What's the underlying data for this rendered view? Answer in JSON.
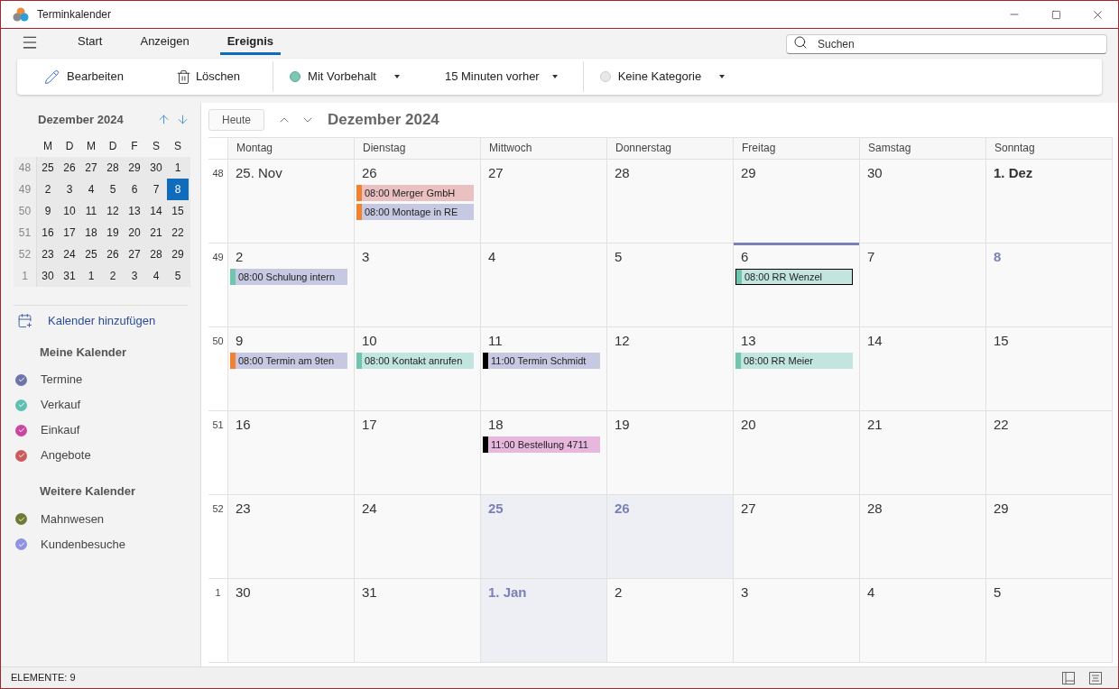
{
  "window": {
    "title": "Terminkalender"
  },
  "tabs": [
    {
      "label": "Start",
      "selected": false
    },
    {
      "label": "Anzeigen",
      "selected": false
    },
    {
      "label": "Ereignis",
      "selected": true
    }
  ],
  "search": {
    "placeholder": "Suchen"
  },
  "ribbon": {
    "edit": "Bearbeiten",
    "delete": "Löschen",
    "status": {
      "label": "Mit Vorbehalt",
      "color": "#7fc6b2"
    },
    "reminder": "15 Minuten vorher",
    "category": {
      "label": "Keine Kategorie",
      "color": "#e8e8e8"
    }
  },
  "mini_calendar": {
    "title": "Dezember 2024",
    "weekdays": [
      "M",
      "D",
      "M",
      "D",
      "F",
      "S",
      "S"
    ],
    "weeks": [
      {
        "number": "48",
        "days": [
          {
            "label": "25",
            "selected": false
          },
          {
            "label": "26",
            "selected": false
          },
          {
            "label": "27",
            "selected": false
          },
          {
            "label": "28",
            "selected": false
          },
          {
            "label": "29",
            "selected": false
          },
          {
            "label": "30",
            "selected": false
          },
          {
            "label": "1",
            "selected": false
          }
        ]
      },
      {
        "number": "49",
        "days": [
          {
            "label": "2",
            "selected": false
          },
          {
            "label": "3",
            "selected": false
          },
          {
            "label": "4",
            "selected": false
          },
          {
            "label": "5",
            "selected": false
          },
          {
            "label": "6",
            "selected": false
          },
          {
            "label": "7",
            "selected": false
          },
          {
            "label": "8",
            "selected": true
          }
        ]
      },
      {
        "number": "50",
        "days": [
          {
            "label": "9",
            "selected": false
          },
          {
            "label": "10",
            "selected": false
          },
          {
            "label": "11",
            "selected": false
          },
          {
            "label": "12",
            "selected": false
          },
          {
            "label": "13",
            "selected": false
          },
          {
            "label": "14",
            "selected": false
          },
          {
            "label": "15",
            "selected": false
          }
        ]
      },
      {
        "number": "51",
        "days": [
          {
            "label": "16",
            "selected": false
          },
          {
            "label": "17",
            "selected": false
          },
          {
            "label": "18",
            "selected": false
          },
          {
            "label": "19",
            "selected": false
          },
          {
            "label": "20",
            "selected": false
          },
          {
            "label": "21",
            "selected": false
          },
          {
            "label": "22",
            "selected": false
          }
        ]
      },
      {
        "number": "52",
        "days": [
          {
            "label": "23",
            "selected": false
          },
          {
            "label": "24",
            "selected": false
          },
          {
            "label": "25",
            "selected": false
          },
          {
            "label": "26",
            "selected": false
          },
          {
            "label": "27",
            "selected": false
          },
          {
            "label": "28",
            "selected": false
          },
          {
            "label": "29",
            "selected": false
          }
        ]
      },
      {
        "number": "1",
        "days": [
          {
            "label": "30",
            "selected": false
          },
          {
            "label": "31",
            "selected": false
          },
          {
            "label": "1",
            "selected": false
          },
          {
            "label": "2",
            "selected": false
          },
          {
            "label": "3",
            "selected": false
          },
          {
            "label": "4",
            "selected": false
          },
          {
            "label": "5",
            "selected": false
          }
        ]
      }
    ]
  },
  "add_calendar": "Kalender hinzufügen",
  "calendar_groups": [
    {
      "title": "Meine Kalender",
      "items": [
        {
          "label": "Termine",
          "color": "#6e74a9",
          "checked": true
        },
        {
          "label": "Verkauf",
          "color": "#5fbfb0",
          "checked": true
        },
        {
          "label": "Einkauf",
          "color": "#c9479e",
          "checked": true
        },
        {
          "label": "Angebote",
          "color": "#cc5c5c",
          "checked": true
        }
      ]
    },
    {
      "title": "Weitere Kalender",
      "items": [
        {
          "label": "Mahnwesen",
          "color": "#6f7a35",
          "checked": true
        },
        {
          "label": "Kundenbesuche",
          "color": "#8f93e0",
          "checked": true
        }
      ]
    }
  ],
  "month_view": {
    "today_button": "Heute",
    "title": "Dezember 2024",
    "weekdays": [
      "Montag",
      "Dienstag",
      "Mittwoch",
      "Donnerstag",
      "Freitag",
      "Samstag",
      "Sonntag"
    ],
    "weeks": [
      {
        "number": "48",
        "days": [
          {
            "label": "25. Nov",
            "kind": "plain",
            "selected": false
          },
          {
            "label": "26",
            "kind": "plain",
            "selected": false,
            "events": [
              {
                "text": "08:00 Merger GmbH",
                "color": "#f4812e",
                "kind": "angebote",
                "selected": false
              },
              {
                "text": "08:00 Montage in RE",
                "color": "#f4812e",
                "kind": "termine",
                "selected": false
              }
            ]
          },
          {
            "label": "27",
            "kind": "plain",
            "selected": false
          },
          {
            "label": "28",
            "kind": "plain",
            "selected": false
          },
          {
            "label": "29",
            "kind": "plain",
            "selected": false
          },
          {
            "label": "30",
            "kind": "plain",
            "selected": false
          },
          {
            "label": "1. Dez",
            "kind": "bold",
            "selected": false
          }
        ]
      },
      {
        "number": "49",
        "days": [
          {
            "label": "2",
            "kind": "plain",
            "selected": false,
            "events": [
              {
                "text": "08:00 Schulung intern",
                "color": "#6fc6ac",
                "kind": "termine",
                "selected": false
              }
            ]
          },
          {
            "label": "3",
            "kind": "plain",
            "selected": false
          },
          {
            "label": "4",
            "kind": "plain",
            "selected": false
          },
          {
            "label": "5",
            "kind": "plain",
            "selected": false
          },
          {
            "label": "6",
            "kind": "plain",
            "selected": true,
            "events": [
              {
                "text": "08:00 RR Wenzel",
                "color": "#6fc6ac",
                "kind": "verkauf",
                "selected": true
              }
            ]
          },
          {
            "label": "7",
            "kind": "plain",
            "selected": false
          },
          {
            "label": "8",
            "kind": "today",
            "selected": false
          }
        ]
      },
      {
        "number": "50",
        "days": [
          {
            "label": "9",
            "kind": "plain",
            "selected": false,
            "events": [
              {
                "text": "08:00 Termin am 9ten",
                "color": "#f4812e",
                "kind": "termine",
                "selected": false
              }
            ]
          },
          {
            "label": "10",
            "kind": "plain",
            "selected": false,
            "events": [
              {
                "text": "08:00 Kontakt anrufen",
                "color": "#6fc6ac",
                "kind": "verkauf",
                "selected": false
              }
            ]
          },
          {
            "label": "11",
            "kind": "plain",
            "selected": false,
            "events": [
              {
                "text": "11:00 Termin Schmidt",
                "color": "#000000",
                "kind": "termine",
                "selected": false
              }
            ]
          },
          {
            "label": "12",
            "kind": "plain",
            "selected": false
          },
          {
            "label": "13",
            "kind": "plain",
            "selected": false,
            "events": [
              {
                "text": "08:00 RR Meier",
                "color": "#6fc6ac",
                "kind": "verkauf",
                "selected": false
              }
            ]
          },
          {
            "label": "14",
            "kind": "plain",
            "selected": false
          },
          {
            "label": "15",
            "kind": "plain",
            "selected": false
          }
        ]
      },
      {
        "number": "51",
        "days": [
          {
            "label": "16",
            "kind": "plain",
            "selected": false
          },
          {
            "label": "17",
            "kind": "plain",
            "selected": false
          },
          {
            "label": "18",
            "kind": "plain",
            "selected": false,
            "events": [
              {
                "text": "11:00 Bestellung 4711",
                "color": "#000000",
                "kind": "einkauf",
                "selected": false
              }
            ]
          },
          {
            "label": "19",
            "kind": "plain",
            "selected": false
          },
          {
            "label": "20",
            "kind": "plain",
            "selected": false
          },
          {
            "label": "21",
            "kind": "plain",
            "selected": false
          },
          {
            "label": "22",
            "kind": "plain",
            "selected": false
          }
        ]
      },
      {
        "number": "52",
        "days": [
          {
            "label": "23",
            "kind": "plain",
            "selected": false
          },
          {
            "label": "24",
            "kind": "plain",
            "selected": false
          },
          {
            "label": "25",
            "kind": "holiday",
            "selected": false
          },
          {
            "label": "26",
            "kind": "holiday",
            "selected": false
          },
          {
            "label": "27",
            "kind": "plain",
            "selected": false
          },
          {
            "label": "28",
            "kind": "plain",
            "selected": false
          },
          {
            "label": "29",
            "kind": "plain",
            "selected": false
          }
        ]
      },
      {
        "number": "1",
        "days": [
          {
            "label": "30",
            "kind": "plain",
            "selected": false
          },
          {
            "label": "31",
            "kind": "plain",
            "selected": false
          },
          {
            "label": "1. Jan",
            "kind": "holiday",
            "selected": false
          },
          {
            "label": "2",
            "kind": "plain",
            "selected": false
          },
          {
            "label": "3",
            "kind": "plain",
            "selected": false
          },
          {
            "label": "4",
            "kind": "plain",
            "selected": false
          },
          {
            "label": "5",
            "kind": "plain",
            "selected": false
          }
        ]
      }
    ]
  },
  "status_bar": {
    "text": "ELEMENTE: 9"
  }
}
